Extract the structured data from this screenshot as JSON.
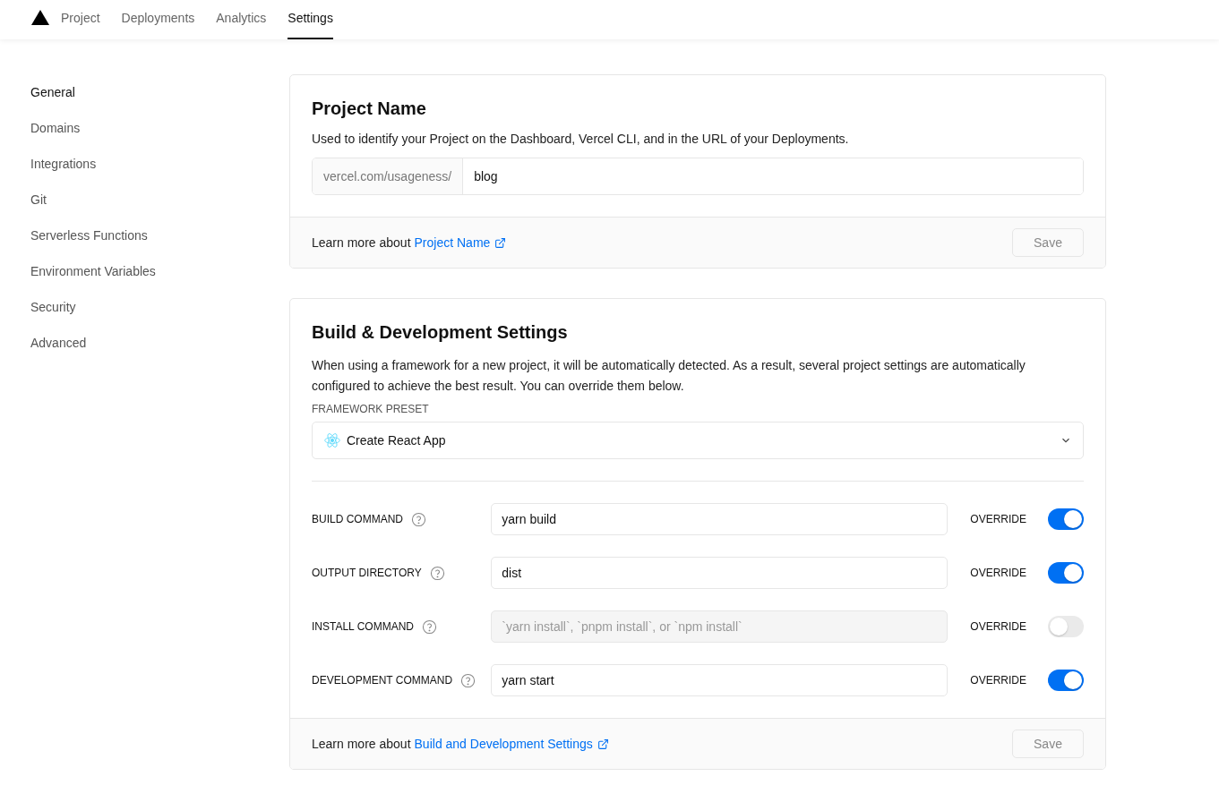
{
  "nav": {
    "tabs": [
      {
        "label": "Project",
        "selected": false
      },
      {
        "label": "Deployments",
        "selected": false
      },
      {
        "label": "Analytics",
        "selected": false
      },
      {
        "label": "Settings",
        "selected": true
      }
    ]
  },
  "sidebar": {
    "items": [
      {
        "label": "General",
        "selected": true
      },
      {
        "label": "Domains",
        "selected": false
      },
      {
        "label": "Integrations",
        "selected": false
      },
      {
        "label": "Git",
        "selected": false
      },
      {
        "label": "Serverless Functions",
        "selected": false
      },
      {
        "label": "Environment Variables",
        "selected": false
      },
      {
        "label": "Security",
        "selected": false
      },
      {
        "label": "Advanced",
        "selected": false
      }
    ]
  },
  "project_name": {
    "title": "Project Name",
    "description": "Used to identify your Project on the Dashboard, Vercel CLI, and in the URL of your Deployments.",
    "prefix": "vercel.com/usageness/",
    "value": "blog",
    "footer_text": "Learn more about",
    "footer_link": "Project Name",
    "save": "Save"
  },
  "build_settings": {
    "title": "Build & Development Settings",
    "description": "When using a framework for a new project, it will be automatically detected. As a result, several project settings are automatically configured to achieve the best result. You can override them below.",
    "preset_label": "FRAMEWORK PRESET",
    "preset_value": "Create React App",
    "rows": [
      {
        "label": "BUILD COMMAND",
        "value": "yarn build",
        "override_label": "OVERRIDE",
        "override": true
      },
      {
        "label": "OUTPUT DIRECTORY",
        "value": "dist",
        "override_label": "OVERRIDE",
        "override": true
      },
      {
        "label": "INSTALL COMMAND",
        "placeholder": "`yarn install`, `pnpm install`, or `npm install`",
        "override_label": "OVERRIDE",
        "override": false
      },
      {
        "label": "DEVELOPMENT COMMAND",
        "value": "yarn start",
        "override_label": "OVERRIDE",
        "override": true
      }
    ],
    "footer_text": "Learn more about",
    "footer_link": "Build and Development Settings",
    "save": "Save"
  }
}
